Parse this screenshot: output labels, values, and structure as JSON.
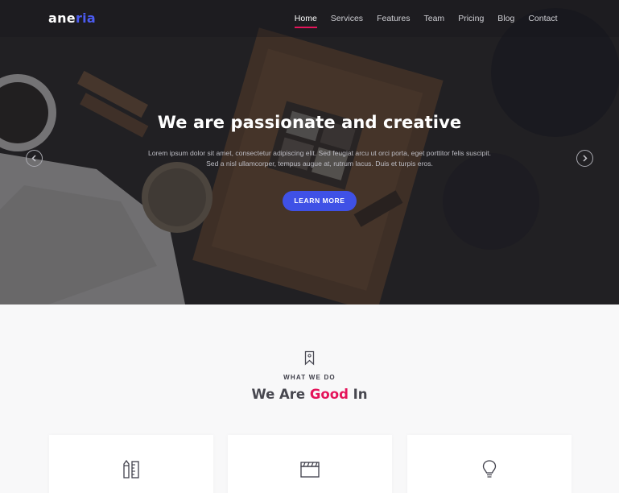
{
  "brand": {
    "logo_part1": "ane",
    "logo_part2": "ria",
    "accent_color": "#e4145a",
    "button_color": "#3f51e6"
  },
  "nav": {
    "items": [
      {
        "label": "Home",
        "active": true
      },
      {
        "label": "Services"
      },
      {
        "label": "Features"
      },
      {
        "label": "Team"
      },
      {
        "label": "Pricing"
      },
      {
        "label": "Blog"
      },
      {
        "label": "Contact"
      }
    ]
  },
  "hero": {
    "title": "We are passionate and creative",
    "text": "Lorem ipsum dolor sit amet, consectetur adipiscing elit. Sed feugiat arcu ut orci porta, eget porttitor felis suscipit. Sed a nisl ullamcorper, tempus augue at, rutrum lacus. Duis et turpis eros.",
    "button_label": "LEARN MORE",
    "prev_icon": "chevron-left-icon",
    "next_icon": "chevron-right-icon"
  },
  "services": {
    "section_icon": "bookmark-icon",
    "eyebrow": "WHAT WE DO",
    "title_part1": "We Are ",
    "title_accent": "Good",
    "title_part2": " In",
    "cards": [
      {
        "icon": "pencil-ruler-icon"
      },
      {
        "icon": "clapperboard-icon"
      },
      {
        "icon": "lightbulb-icon"
      }
    ]
  }
}
